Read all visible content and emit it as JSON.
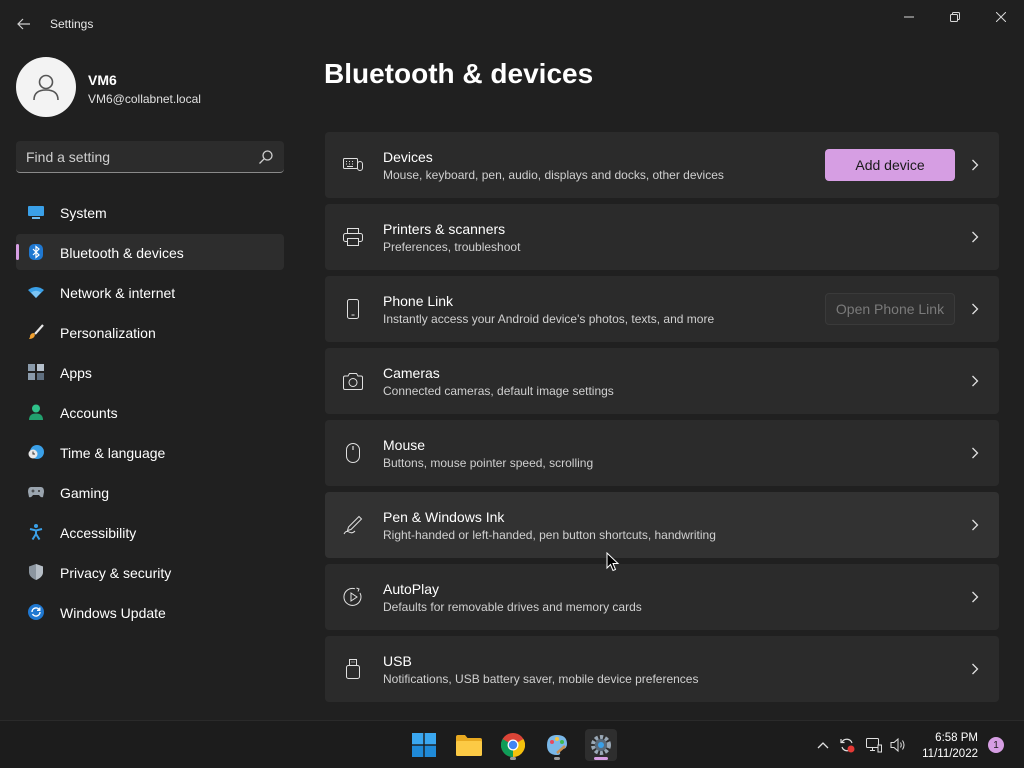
{
  "window": {
    "app_title": "Settings"
  },
  "profile": {
    "name": "VM6",
    "email": "VM6@collabnet.local"
  },
  "search": {
    "placeholder": "Find a setting",
    "value": ""
  },
  "nav": {
    "selected": "Bluetooth & devices",
    "items": [
      {
        "label": "System",
        "icon": "system-icon"
      },
      {
        "label": "Bluetooth & devices",
        "icon": "bluetooth-icon"
      },
      {
        "label": "Network & internet",
        "icon": "wifi-icon"
      },
      {
        "label": "Personalization",
        "icon": "brush-icon"
      },
      {
        "label": "Apps",
        "icon": "apps-icon"
      },
      {
        "label": "Accounts",
        "icon": "person-icon"
      },
      {
        "label": "Time & language",
        "icon": "clock-globe-icon"
      },
      {
        "label": "Gaming",
        "icon": "gamepad-icon"
      },
      {
        "label": "Accessibility",
        "icon": "accessibility-icon"
      },
      {
        "label": "Privacy & security",
        "icon": "shield-icon"
      },
      {
        "label": "Windows Update",
        "icon": "update-icon"
      }
    ]
  },
  "main": {
    "title": "Bluetooth & devices",
    "cards": [
      {
        "title": "Devices",
        "subtitle": "Mouse, keyboard, pen, audio, displays and docks, other devices",
        "icon": "devices-icon",
        "button": "Add device"
      },
      {
        "title": "Printers & scanners",
        "subtitle": "Preferences, troubleshoot",
        "icon": "printer-icon"
      },
      {
        "title": "Phone Link",
        "subtitle": "Instantly access your Android device's photos, texts, and more",
        "icon": "phone-icon",
        "button": "Open Phone Link"
      },
      {
        "title": "Cameras",
        "subtitle": "Connected cameras, default image settings",
        "icon": "camera-icon"
      },
      {
        "title": "Mouse",
        "subtitle": "Buttons, mouse pointer speed, scrolling",
        "icon": "mouse-icon"
      },
      {
        "title": "Pen & Windows Ink",
        "subtitle": "Right-handed or left-handed, pen button shortcuts, handwriting",
        "icon": "pen-icon"
      },
      {
        "title": "AutoPlay",
        "subtitle": "Defaults for removable drives and memory cards",
        "icon": "autoplay-icon"
      },
      {
        "title": "USB",
        "subtitle": "Notifications, USB battery saver, mobile device preferences",
        "icon": "usb-icon"
      }
    ]
  },
  "taskbar": {
    "apps": [
      "start-icon",
      "file-explorer-icon",
      "chrome-icon",
      "paint-icon",
      "settings-icon"
    ],
    "tray": [
      "chevron-up-icon",
      "sync-icon",
      "network-icon",
      "volume-icon"
    ],
    "time": "6:58 PM",
    "date": "11/11/2022",
    "notifications": "1"
  },
  "colors": {
    "accent": "#d69ee3",
    "background": "#202020",
    "card": "#2b2b2b"
  }
}
